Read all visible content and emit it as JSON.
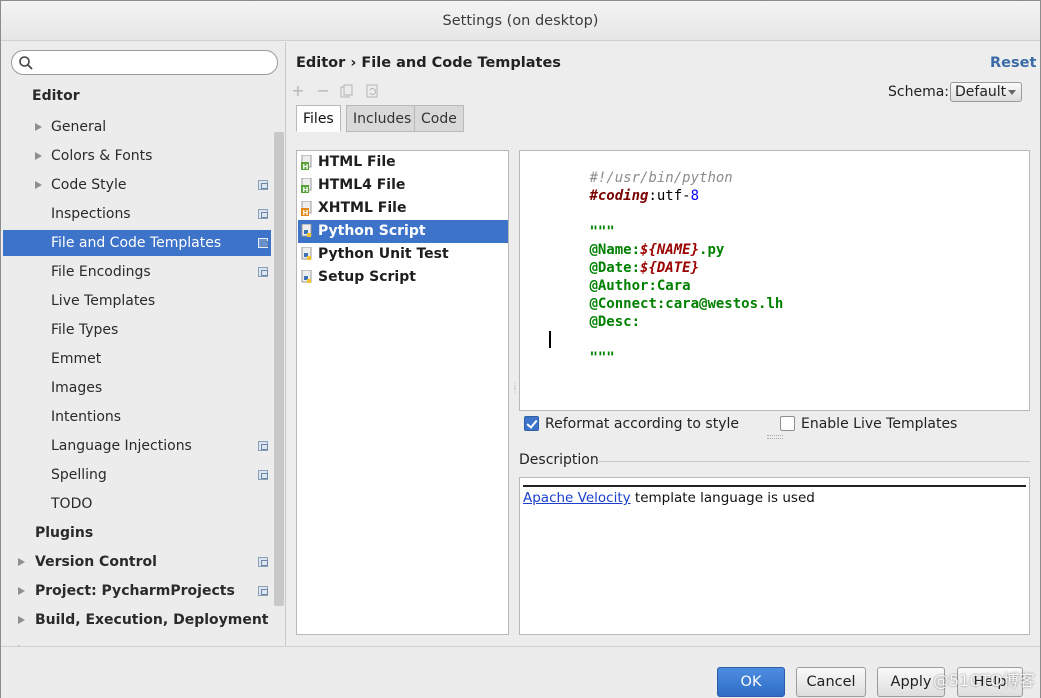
{
  "window": {
    "title": "Settings (on desktop)"
  },
  "search": {
    "placeholder": ""
  },
  "sidebar": {
    "items": [
      {
        "label": "Editor"
      },
      {
        "label": "General"
      },
      {
        "label": "Colors & Fonts"
      },
      {
        "label": "Code Style"
      },
      {
        "label": "Inspections"
      },
      {
        "label": "File and Code Templates"
      },
      {
        "label": "File Encodings"
      },
      {
        "label": "Live Templates"
      },
      {
        "label": "File Types"
      },
      {
        "label": "Emmet"
      },
      {
        "label": "Images"
      },
      {
        "label": "Intentions"
      },
      {
        "label": "Language Injections"
      },
      {
        "label": "Spelling"
      },
      {
        "label": "TODO"
      },
      {
        "label": "Plugins"
      },
      {
        "label": "Version Control"
      },
      {
        "label": "Project: PycharmProjects"
      },
      {
        "label": "Build, Execution, Deployment"
      }
    ]
  },
  "header": {
    "breadcrumb": "Editor › File and Code Templates",
    "reset": "Reset",
    "schema_label": "Schema:",
    "schema_value": "Default"
  },
  "tabs": [
    {
      "label": "Files"
    },
    {
      "label": "Includes"
    },
    {
      "label": "Code"
    }
  ],
  "templates": [
    {
      "label": "HTML File",
      "icon": "html-file-icon"
    },
    {
      "label": "HTML4 File",
      "icon": "html-file-icon"
    },
    {
      "label": "XHTML File",
      "icon": "html-file-icon"
    },
    {
      "label": "Python Script",
      "icon": "python-file-icon"
    },
    {
      "label": "Python Unit Test",
      "icon": "python-file-icon"
    },
    {
      "label": "Setup Script",
      "icon": "python-file-icon"
    }
  ],
  "editor": {
    "lines": [
      {
        "parts": [
          "#!/usr/bin/python"
        ]
      },
      {
        "parts": [
          "#coding",
          ":utf-",
          "8"
        ]
      },
      {
        "parts": [
          ""
        ]
      },
      {
        "parts": [
          "\"\"\""
        ]
      },
      {
        "parts": [
          "@Name:",
          "${NAME}",
          ".py"
        ]
      },
      {
        "parts": [
          "@Date:",
          "${DATE}"
        ]
      },
      {
        "parts": [
          "@Author:Cara"
        ]
      },
      {
        "parts": [
          "@Connect:cara@westos.lh"
        ]
      },
      {
        "parts": [
          "@Desc:"
        ]
      },
      {
        "parts": [
          ""
        ]
      },
      {
        "parts": [
          "\"\"\""
        ]
      }
    ]
  },
  "options": {
    "reformat_label": "Reformat according to style",
    "reformat_checked": true,
    "live_label": "Enable Live Templates",
    "live_checked": false
  },
  "description": {
    "label": "Description",
    "link_text": "Apache Velocity",
    "rest_text": " template language is used"
  },
  "buttons": {
    "ok": "OK",
    "cancel": "Cancel",
    "apply": "Apply",
    "help": "Help"
  },
  "watermark": "@51CTO博客",
  "colors": {
    "selection": "#3d74c9",
    "link": "#1a3fcc",
    "accent": "#3b6aa8"
  }
}
